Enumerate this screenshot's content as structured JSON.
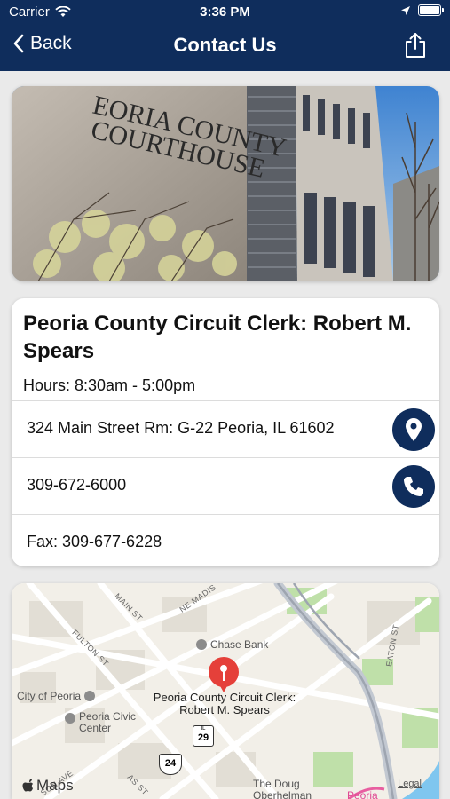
{
  "status_bar": {
    "carrier": "Carrier",
    "time": "3:36 PM"
  },
  "nav": {
    "back_label": "Back",
    "title": "Contact Us"
  },
  "hero": {
    "sign_line1": "EORIA COUNTY",
    "sign_line2": "COURTHOUSE"
  },
  "contact": {
    "title": "Peoria County Circuit Clerk: Robert M. Spears",
    "hours": "Hours: 8:30am - 5:00pm",
    "address": "324 Main Street Rm: G-22 Peoria, IL 61602",
    "phone": "309-672-6000",
    "fax": "Fax: 309-677-6228"
  },
  "map": {
    "pin_label": "Peoria County Circuit Clerk: Robert M. Spears",
    "poi_chase": "Chase Bank",
    "poi_city": "City of Peoria",
    "poi_civic": "Peoria Civic Center",
    "poi_doug": "The Doug Oberhelman",
    "poi_peoria": "Peoria",
    "street_main": "MAIN ST",
    "street_ne_madison": "NE MADIS",
    "street_fulton": "FULTON ST",
    "street_eaton": "EATON ST",
    "street_ave": "SON AVE",
    "street_ms": "AS ST",
    "shield_29": "29",
    "shield_29_top": "IL",
    "shield_24": "24",
    "logo_text": "Maps",
    "legal": "Legal"
  }
}
